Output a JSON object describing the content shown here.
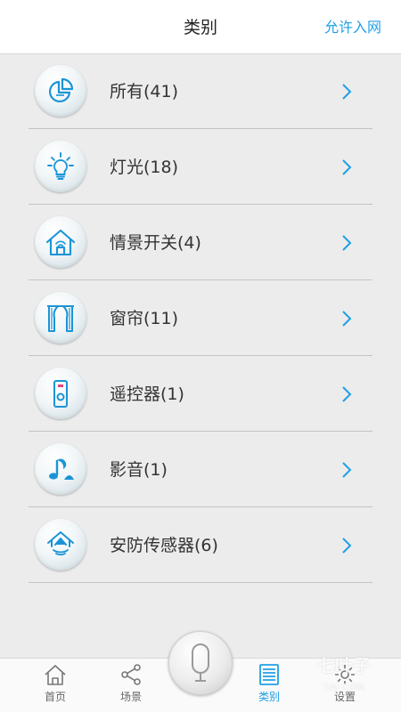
{
  "header": {
    "title": "类别",
    "action_label": "允许入网"
  },
  "categories": [
    {
      "label": "所有(41)",
      "icon": "pie-chart-icon"
    },
    {
      "label": "灯光(18)",
      "icon": "lightbulb-icon"
    },
    {
      "label": "情景开关(4)",
      "icon": "home-wifi-icon"
    },
    {
      "label": "窗帘(11)",
      "icon": "curtain-icon"
    },
    {
      "label": "遥控器(1)",
      "icon": "remote-control-icon"
    },
    {
      "label": "影音(1)",
      "icon": "music-note-icon"
    },
    {
      "label": "安防传感器(6)",
      "icon": "security-sensor-icon"
    }
  ],
  "tabbar": {
    "home_label": "首页",
    "scene_label": "场景",
    "category_label": "类别",
    "settings_label": "设置"
  },
  "watermark": {
    "text": "七叶子",
    "sub": "7AI.COM"
  },
  "colors": {
    "accent": "#1fa0e8",
    "background": "#ececec",
    "header_bg": "#ffffff",
    "text": "#333333",
    "divider": "#c4c4c4"
  }
}
